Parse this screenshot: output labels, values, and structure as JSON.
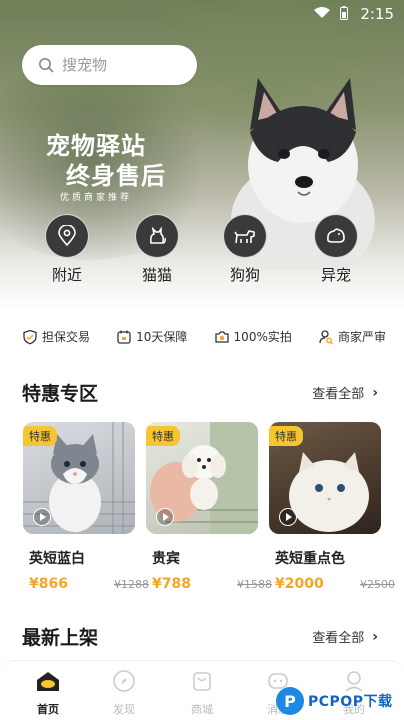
{
  "status_bar": {
    "time": "2:15"
  },
  "search": {
    "placeholder": "搜宠物"
  },
  "banner": {
    "line1": "宠物驿站",
    "line2": "终身售后",
    "line3": "优质商家推荐"
  },
  "categories": [
    {
      "label": "附近",
      "icon": "location-icon"
    },
    {
      "label": "猫猫",
      "icon": "cat-icon"
    },
    {
      "label": "狗狗",
      "icon": "dog-icon"
    },
    {
      "label": "异宠",
      "icon": "exotic-pet-icon"
    }
  ],
  "guarantees": [
    {
      "label": "担保交易",
      "icon": "shield-icon"
    },
    {
      "label": "10天保障",
      "icon": "calendar-icon"
    },
    {
      "label": "100%实拍",
      "icon": "camera-icon"
    },
    {
      "label": "商家严审",
      "icon": "audit-icon"
    }
  ],
  "special": {
    "title": "特惠专区",
    "see_all": "查看全部",
    "products": [
      {
        "tag": "特惠",
        "name": "英短蓝白",
        "price": "¥866",
        "original": "¥1288"
      },
      {
        "tag": "特惠",
        "name": "贵宾",
        "price": "¥788",
        "original": "¥1588"
      },
      {
        "tag": "特惠",
        "name": "英短重点色",
        "price": "¥2000",
        "original": "¥2500"
      }
    ]
  },
  "latest": {
    "title": "最新上架",
    "see_all": "查看全部"
  },
  "nav": [
    {
      "label": "首页",
      "icon": "home-icon",
      "active": true
    },
    {
      "label": "发现",
      "icon": "compass-icon"
    },
    {
      "label": "商城",
      "icon": "shop-icon"
    },
    {
      "label": "消息",
      "icon": "message-icon"
    },
    {
      "label": "我的",
      "icon": "profile-icon"
    }
  ],
  "watermark": {
    "logo": "P",
    "text": "PCPOP下载"
  },
  "colors": {
    "accent": "#f7c531",
    "price": "#f4a623",
    "dark_circle": "#3a3a3a"
  }
}
